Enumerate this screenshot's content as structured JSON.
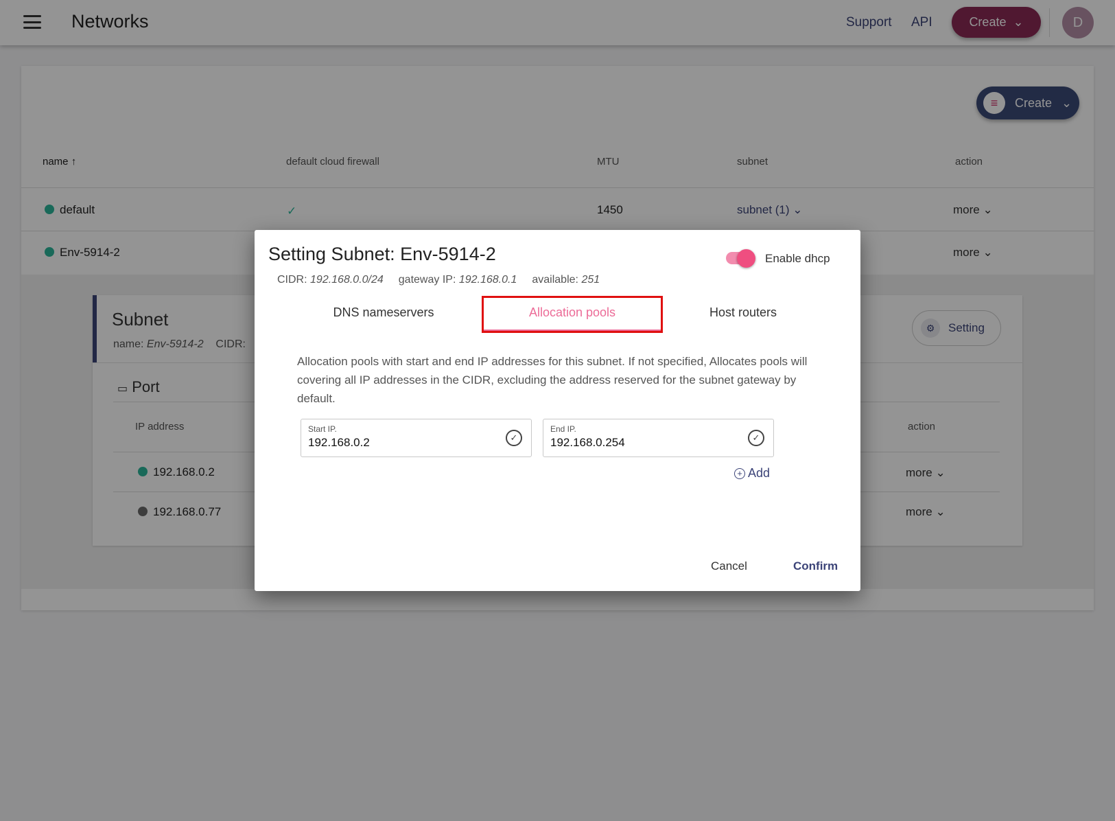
{
  "topbar": {
    "title": "Networks",
    "support": "Support",
    "api": "API",
    "create": "Create",
    "avatar_initial": "D"
  },
  "table": {
    "create_button": "Create",
    "headers": {
      "name": "name",
      "firewall": "default cloud firewall",
      "mtu": "MTU",
      "subnet": "subnet",
      "action": "action"
    },
    "rows": [
      {
        "name": "default",
        "firewall": "✓",
        "mtu": "1450",
        "subnet": "subnet (1)",
        "action": "more"
      },
      {
        "name": "Env-5914-2",
        "action": "more"
      }
    ]
  },
  "subnet_panel": {
    "title": "Subnet",
    "name_label": "name:",
    "name_value": "Env-5914-2",
    "cidr_label": "CIDR:",
    "setting": "Setting",
    "port_title": "Port",
    "headers": {
      "ip": "IP address",
      "action": "action"
    },
    "ports": [
      {
        "ip": "192.168.0.2",
        "action": "more",
        "status_color": "#2bb59a"
      },
      {
        "ip": "192.168.0.77",
        "action": "more",
        "status_color": "#6a6a6a"
      }
    ]
  },
  "modal": {
    "title": "Setting Subnet: Env-5914-2",
    "cidr_label": "CIDR:",
    "cidr_value": "192.168.0.0/24",
    "gateway_label": "gateway IP:",
    "gateway_value": "192.168.0.1",
    "available_label": "available:",
    "available_value": "251",
    "dhcp_label": "Enable dhcp",
    "dhcp_enabled": true,
    "tabs": [
      "DNS nameservers",
      "Allocation pools",
      "Host routers"
    ],
    "active_tab": "Allocation pools",
    "description": "Allocation pools with start and end IP addresses for this subnet. If not specified, Allocates pools will covering all IP addresses in the CIDR, excluding the address reserved for the subnet gateway by default.",
    "start_ip": {
      "label": "Start IP.",
      "value": "192.168.0.2"
    },
    "end_ip": {
      "label": "End IP.",
      "value": "192.168.0.254"
    },
    "add": "Add",
    "cancel": "Cancel",
    "confirm": "Confirm"
  },
  "colors": {
    "primary": "#3c4478",
    "accent": "#ec6b97",
    "brand_create": "#8a2a55",
    "status_green": "#2bb59a",
    "highlight_red": "#e01010"
  }
}
